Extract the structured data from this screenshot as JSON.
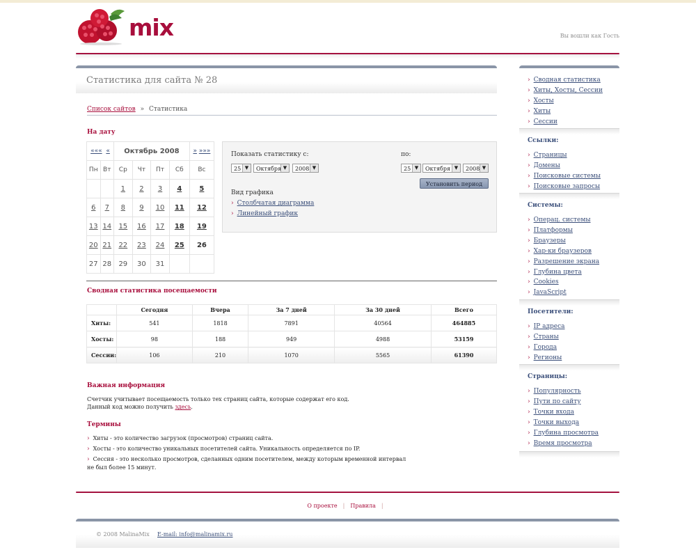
{
  "header": {
    "logo_text": "mix",
    "welcome": "Вы вошли как Гость"
  },
  "main": {
    "title": "Статистика для сайта № 28",
    "breadcrumb": {
      "link": "Список сайтов",
      "sep": "»",
      "current": "Статистика"
    },
    "date_heading": "На дату",
    "calendar": {
      "prev_year": "«««",
      "prev_month": "«",
      "month": "Октябрь 2008",
      "next_month": "»",
      "next_year": "»»»",
      "weekdays": [
        "Пн",
        "Вт",
        "Ср",
        "Чт",
        "Пт",
        "Сб",
        "Вс"
      ],
      "weeks": [
        [
          "",
          "",
          "1",
          "2",
          "3",
          "4",
          "5"
        ],
        [
          "6",
          "7",
          "8",
          "9",
          "10",
          "11",
          "12"
        ],
        [
          "13",
          "14",
          "15",
          "16",
          "17",
          "18",
          "19"
        ],
        [
          "20",
          "21",
          "22",
          "23",
          "24",
          "25",
          "26"
        ],
        [
          "27",
          "28",
          "29",
          "30",
          "31",
          "",
          ""
        ]
      ],
      "linked": [
        "1",
        "2",
        "3",
        "4",
        "5",
        "6",
        "7",
        "8",
        "9",
        "10",
        "11",
        "12",
        "13",
        "14",
        "15",
        "16",
        "17",
        "18",
        "19",
        "20",
        "21",
        "22",
        "23",
        "24",
        "25"
      ],
      "bold": [
        "4",
        "5",
        "11",
        "12",
        "18",
        "19",
        "25",
        "26"
      ]
    },
    "period": {
      "from_label": "Показать статистику с:",
      "to_label": "по:",
      "from": {
        "day": "25",
        "month": "Октября",
        "year": "2008"
      },
      "to": {
        "day": "25",
        "month": "Октября",
        "year": "2008"
      },
      "button": "Установить период",
      "chart_type_label": "Вид графика",
      "chart_links": [
        "Столбчатая диаграмма",
        "Линейный график"
      ]
    },
    "summary": {
      "heading": "Сводная статистика посещаемости",
      "columns": [
        "",
        "Сегодня",
        "Вчера",
        "За 7 дней",
        "За 30 дней",
        "Всего"
      ],
      "rows": [
        {
          "label": "Хиты:",
          "values": [
            "541",
            "1818",
            "7891",
            "40564",
            "464885"
          ]
        },
        {
          "label": "Хосты:",
          "values": [
            "98",
            "188",
            "949",
            "4988",
            "53159"
          ]
        },
        {
          "label": "Сессии:",
          "values": [
            "106",
            "210",
            "1070",
            "5565",
            "61390"
          ]
        }
      ]
    },
    "info": {
      "heading": "Важная информация",
      "line1": "Счетчик учитывает посещаемость только тех страниц сайта, которые содержат его код.",
      "line2_prefix": "Данный код можно получить ",
      "line2_link": "здесь",
      "line2_suffix": "."
    },
    "terms": {
      "heading": "Термины",
      "items": [
        "Хиты - это количество загрузок (просмотров) страниц сайта.",
        "Хосты - это количество уникальных посетителей сайта. Уникальность определяется по IP.",
        "Сессия - это несколько просмотров, сделанных одним посетителем, между которым временной интервал не был более 15 минут."
      ]
    }
  },
  "sidebar": {
    "sections": [
      {
        "heading": "",
        "items": [
          "Сводная статистика",
          "Хиты, Хосты, Сессии",
          "Хосты",
          "Хиты",
          "Сессии"
        ]
      },
      {
        "heading": "Ссылки:",
        "items": [
          "Страницы",
          "Домены",
          "Поисковые системы",
          "Поисковые запросы"
        ]
      },
      {
        "heading": "Системы:",
        "items": [
          "Операц. системы",
          "Платформы",
          "Браузеры",
          "Хар-ки браузеров",
          "Разрешение экрана",
          "Глубина цвета",
          "Cookies",
          "JavaScript"
        ]
      },
      {
        "heading": "Посетители:",
        "items": [
          "IP адреса",
          "Страны",
          "Города",
          "Регионы"
        ]
      },
      {
        "heading": "Страницы:",
        "items": [
          "Популярность",
          "Пути по сайту",
          "Точки входа",
          "Точки выхода",
          "Глубина просмотра",
          "Время просмотра"
        ]
      }
    ]
  },
  "footer": {
    "links": [
      "О проекте",
      "Правила"
    ],
    "copyright": "© 2008 MalinaMix",
    "email": "E-mail: info@malinamix.ru"
  },
  "colors": {
    "accent": "#a80e3c",
    "link": "#3b4f7a",
    "panel_border": "#8a95a7"
  }
}
